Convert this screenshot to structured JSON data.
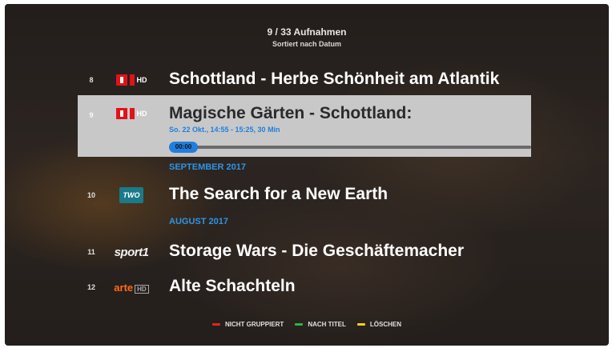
{
  "header": {
    "count": "9 / 33 Aufnahmen",
    "sort": "Sortiert nach Datum"
  },
  "rows": [
    {
      "num": "8",
      "logo": "SRF 1 HD",
      "title": "Schottland - Herbe Schönheit am Atlantik"
    },
    {
      "num": "9",
      "logo": "SRF 1 HD",
      "title": "Magische Gärten - Schottland:",
      "sub": "So. 22 Okt., 14:55 - 15:25, 30 Min",
      "time": "00:00",
      "progress": 0.0
    },
    {
      "num": "10",
      "logo": "BBC TWO",
      "title": "The Search for a New Earth"
    },
    {
      "num": "11",
      "logo": "sport1",
      "title": "Storage Wars - Die Geschäftemacher"
    },
    {
      "num": "12",
      "logo": "arte HD",
      "title": "Alte Schachteln"
    }
  ],
  "sections": {
    "sep2017": "SEPTEMBER 2017",
    "aug2017": "AUGUST 2017"
  },
  "footer": {
    "red": "NICHT GRUPPIERT",
    "green": "NACH TITEL",
    "yellow": "LÖSCHEN",
    "colors": {
      "red": "#e02424",
      "green": "#2db34a",
      "yellow": "#f2d21b"
    }
  },
  "accent": "#1f7fe0"
}
